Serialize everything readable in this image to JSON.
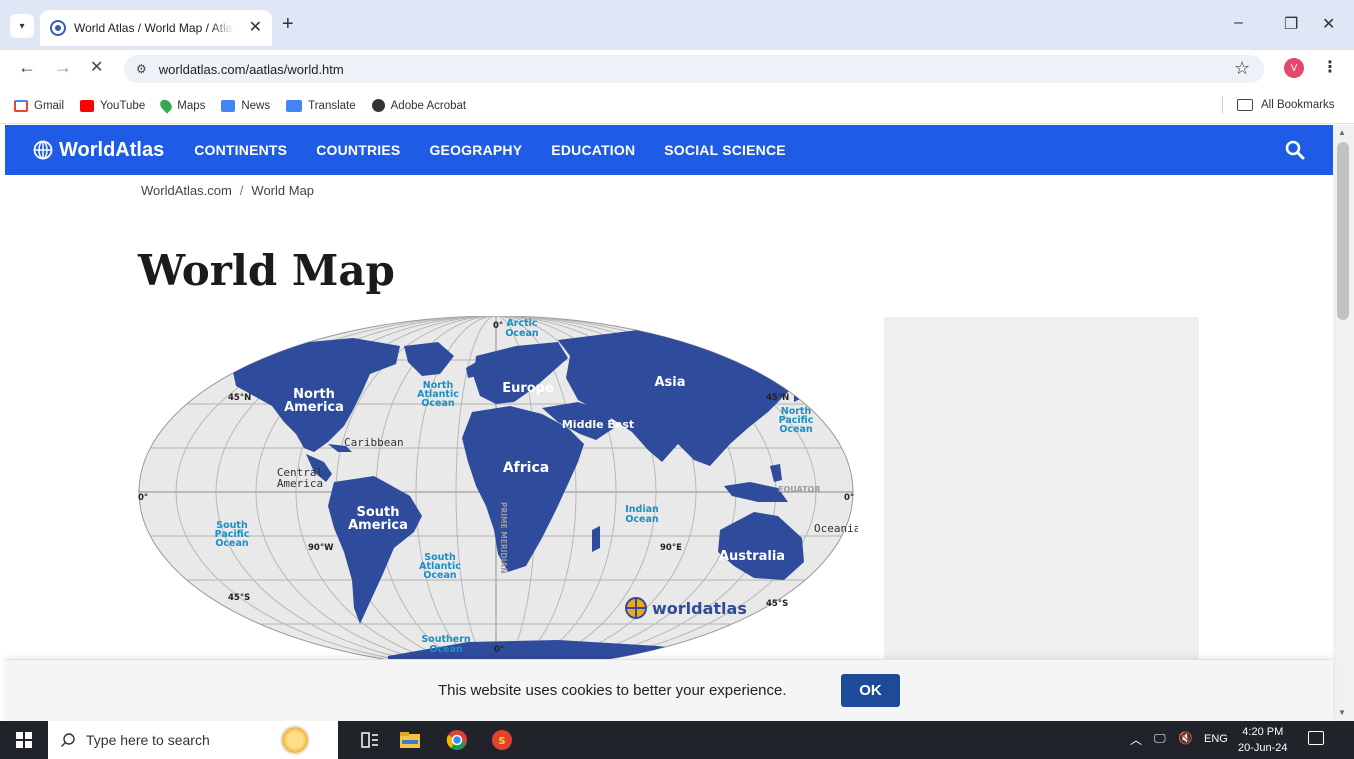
{
  "browser": {
    "tab": {
      "title": "World Atlas / World Map / Atlas",
      "close_glyph": "✕"
    },
    "new_tab_glyph": "+",
    "window": {
      "minimize": "–",
      "restore": "❐",
      "close": "✕"
    },
    "nav": {
      "back": "←",
      "forward": "→",
      "stop": "✕"
    },
    "url": "worldatlas.com/aatlas/world.htm",
    "profile_initial": "V",
    "bookmarks": [
      {
        "label": "Gmail",
        "color": "#ea4335"
      },
      {
        "label": "YouTube",
        "color": "#ff0000"
      },
      {
        "label": "Maps",
        "color": "#34a853"
      },
      {
        "label": "News",
        "color": "#4285f4"
      },
      {
        "label": "Translate",
        "color": "#4285f4"
      },
      {
        "label": "Adobe Acrobat",
        "color": "#333333"
      }
    ],
    "all_bookmarks": "All Bookmarks"
  },
  "site": {
    "brand": "WorldAtlas",
    "nav": [
      "CONTINENTS",
      "COUNTRIES",
      "GEOGRAPHY",
      "EDUCATION",
      "SOCIAL SCIENCE"
    ],
    "accent": "#1e5ce6",
    "breadcrumb": [
      "WorldAtlas.com",
      "World Map"
    ],
    "breadcrumb_sep": "/",
    "title": "World Map"
  },
  "map": {
    "land_color": "#2f4b9b",
    "ocean_label_color": "#1a8fc4",
    "labels": {
      "north_america": [
        "North",
        "America"
      ],
      "south_america": [
        "South",
        "America"
      ],
      "europe": "Europe",
      "asia": "Asia",
      "africa": "Africa",
      "middle_east": "Middle East",
      "australia": "Australia",
      "oceania": "Oceania",
      "caribbean": "Caribbean",
      "central_america": [
        "Central",
        "America"
      ],
      "arctic": [
        "Arctic",
        "Ocean"
      ],
      "north_atlantic": [
        "North",
        "Atlantic",
        "Ocean"
      ],
      "north_pacific": [
        "North",
        "Pacific",
        "Ocean"
      ],
      "south_pacific": [
        "South",
        "Pacific",
        "Ocean"
      ],
      "south_atlantic": [
        "South",
        "Atlantic",
        "Ocean"
      ],
      "indian": [
        "Indian",
        "Ocean"
      ],
      "southern": [
        "Southern",
        "Ocean"
      ],
      "equator": "EQUATOR",
      "prime_meridian": "PRIME MERIDIAN",
      "lat_45n_left": "45°N",
      "lat_45n_right": "45°N",
      "lat_45s_left": "45°S",
      "lat_45s_right": "45°S",
      "lat_0_left": "0°",
      "lat_0_right": "0°",
      "lon_0_top": "0°",
      "lon_0_bottom": "0°",
      "lon_90w": "90°W",
      "lon_90e": "90°E",
      "logo": "worldatlas"
    }
  },
  "cookie": {
    "message": "This website uses cookies to better your experience.",
    "ok": "OK"
  },
  "taskbar": {
    "search_placeholder": "Type here to search",
    "language": "ENG",
    "time": "4:20 PM",
    "date": "20-Jun-24"
  }
}
